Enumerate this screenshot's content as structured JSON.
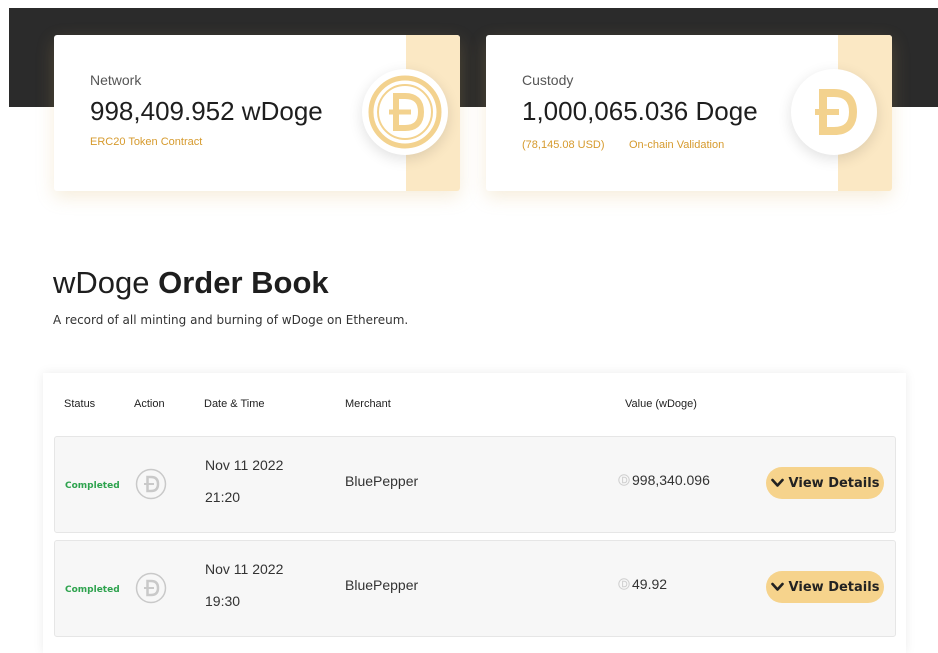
{
  "network": {
    "label": "Network",
    "value": "998,409.952 wDoge",
    "link": "ERC20 Token Contract",
    "icon": "wdoge-coin-icon"
  },
  "custody": {
    "label": "Custody",
    "value": "1,000,065.036 Doge",
    "usd": "(78,145.08 USD)",
    "link": "On-chain Validation",
    "icon": "doge-coin-icon"
  },
  "order_book": {
    "title_light": "wDoge ",
    "title_bold": "Order Book",
    "subtitle": "A record of all minting and burning of wDoge on Ethereum.",
    "columns": [
      "Status",
      "Action",
      "Date & Time",
      "Merchant",
      "Value (wDoge)"
    ],
    "rows": [
      {
        "status": "Completed",
        "action_icon": "mint-icon",
        "date": "Nov 11 2022",
        "time": "21:20",
        "merchant": "BluePepper",
        "value": "998,340.096",
        "button": "View Details"
      },
      {
        "status": "Completed",
        "action_icon": "mint-icon",
        "date": "Nov 11 2022",
        "time": "19:30",
        "merchant": "BluePepper",
        "value": "49.92",
        "button": "View Details"
      }
    ]
  },
  "colors": {
    "accent": "#f6d38c",
    "accent_text": "#d69a2d",
    "status_completed": "#2ea34e",
    "dark_band": "#2b2b2b"
  }
}
